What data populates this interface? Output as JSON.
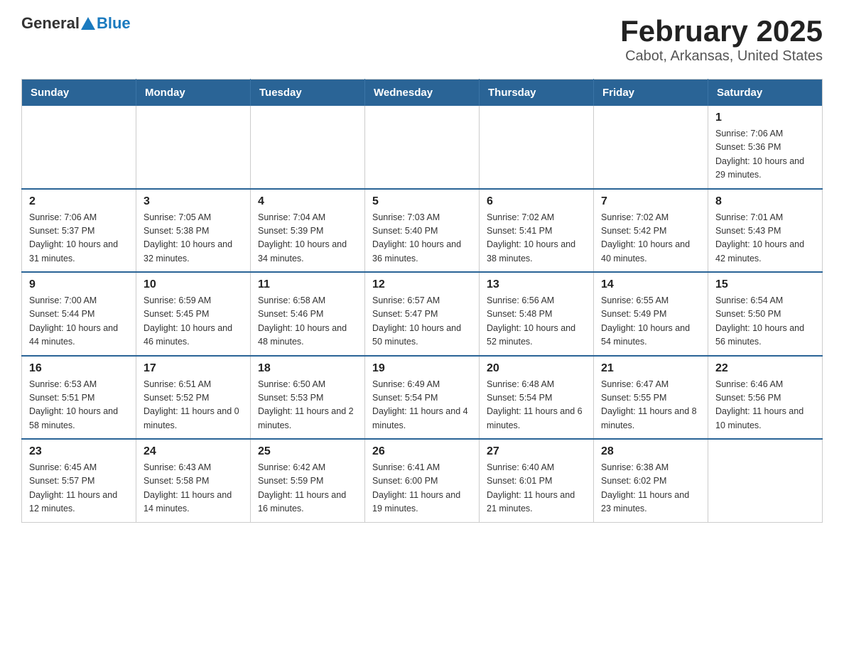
{
  "header": {
    "logo_general": "General",
    "logo_blue": "Blue",
    "title": "February 2025",
    "subtitle": "Cabot, Arkansas, United States"
  },
  "days_of_week": [
    "Sunday",
    "Monday",
    "Tuesday",
    "Wednesday",
    "Thursday",
    "Friday",
    "Saturday"
  ],
  "weeks": [
    [
      {
        "day": "",
        "info": ""
      },
      {
        "day": "",
        "info": ""
      },
      {
        "day": "",
        "info": ""
      },
      {
        "day": "",
        "info": ""
      },
      {
        "day": "",
        "info": ""
      },
      {
        "day": "",
        "info": ""
      },
      {
        "day": "1",
        "info": "Sunrise: 7:06 AM\nSunset: 5:36 PM\nDaylight: 10 hours and 29 minutes."
      }
    ],
    [
      {
        "day": "2",
        "info": "Sunrise: 7:06 AM\nSunset: 5:37 PM\nDaylight: 10 hours and 31 minutes."
      },
      {
        "day": "3",
        "info": "Sunrise: 7:05 AM\nSunset: 5:38 PM\nDaylight: 10 hours and 32 minutes."
      },
      {
        "day": "4",
        "info": "Sunrise: 7:04 AM\nSunset: 5:39 PM\nDaylight: 10 hours and 34 minutes."
      },
      {
        "day": "5",
        "info": "Sunrise: 7:03 AM\nSunset: 5:40 PM\nDaylight: 10 hours and 36 minutes."
      },
      {
        "day": "6",
        "info": "Sunrise: 7:02 AM\nSunset: 5:41 PM\nDaylight: 10 hours and 38 minutes."
      },
      {
        "day": "7",
        "info": "Sunrise: 7:02 AM\nSunset: 5:42 PM\nDaylight: 10 hours and 40 minutes."
      },
      {
        "day": "8",
        "info": "Sunrise: 7:01 AM\nSunset: 5:43 PM\nDaylight: 10 hours and 42 minutes."
      }
    ],
    [
      {
        "day": "9",
        "info": "Sunrise: 7:00 AM\nSunset: 5:44 PM\nDaylight: 10 hours and 44 minutes."
      },
      {
        "day": "10",
        "info": "Sunrise: 6:59 AM\nSunset: 5:45 PM\nDaylight: 10 hours and 46 minutes."
      },
      {
        "day": "11",
        "info": "Sunrise: 6:58 AM\nSunset: 5:46 PM\nDaylight: 10 hours and 48 minutes."
      },
      {
        "day": "12",
        "info": "Sunrise: 6:57 AM\nSunset: 5:47 PM\nDaylight: 10 hours and 50 minutes."
      },
      {
        "day": "13",
        "info": "Sunrise: 6:56 AM\nSunset: 5:48 PM\nDaylight: 10 hours and 52 minutes."
      },
      {
        "day": "14",
        "info": "Sunrise: 6:55 AM\nSunset: 5:49 PM\nDaylight: 10 hours and 54 minutes."
      },
      {
        "day": "15",
        "info": "Sunrise: 6:54 AM\nSunset: 5:50 PM\nDaylight: 10 hours and 56 minutes."
      }
    ],
    [
      {
        "day": "16",
        "info": "Sunrise: 6:53 AM\nSunset: 5:51 PM\nDaylight: 10 hours and 58 minutes."
      },
      {
        "day": "17",
        "info": "Sunrise: 6:51 AM\nSunset: 5:52 PM\nDaylight: 11 hours and 0 minutes."
      },
      {
        "day": "18",
        "info": "Sunrise: 6:50 AM\nSunset: 5:53 PM\nDaylight: 11 hours and 2 minutes."
      },
      {
        "day": "19",
        "info": "Sunrise: 6:49 AM\nSunset: 5:54 PM\nDaylight: 11 hours and 4 minutes."
      },
      {
        "day": "20",
        "info": "Sunrise: 6:48 AM\nSunset: 5:54 PM\nDaylight: 11 hours and 6 minutes."
      },
      {
        "day": "21",
        "info": "Sunrise: 6:47 AM\nSunset: 5:55 PM\nDaylight: 11 hours and 8 minutes."
      },
      {
        "day": "22",
        "info": "Sunrise: 6:46 AM\nSunset: 5:56 PM\nDaylight: 11 hours and 10 minutes."
      }
    ],
    [
      {
        "day": "23",
        "info": "Sunrise: 6:45 AM\nSunset: 5:57 PM\nDaylight: 11 hours and 12 minutes."
      },
      {
        "day": "24",
        "info": "Sunrise: 6:43 AM\nSunset: 5:58 PM\nDaylight: 11 hours and 14 minutes."
      },
      {
        "day": "25",
        "info": "Sunrise: 6:42 AM\nSunset: 5:59 PM\nDaylight: 11 hours and 16 minutes."
      },
      {
        "day": "26",
        "info": "Sunrise: 6:41 AM\nSunset: 6:00 PM\nDaylight: 11 hours and 19 minutes."
      },
      {
        "day": "27",
        "info": "Sunrise: 6:40 AM\nSunset: 6:01 PM\nDaylight: 11 hours and 21 minutes."
      },
      {
        "day": "28",
        "info": "Sunrise: 6:38 AM\nSunset: 6:02 PM\nDaylight: 11 hours and 23 minutes."
      },
      {
        "day": "",
        "info": ""
      }
    ]
  ]
}
